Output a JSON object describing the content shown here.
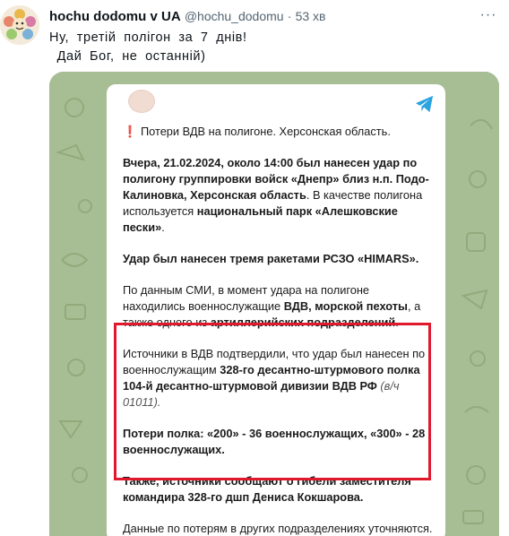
{
  "tweet": {
    "display_name": "hochu dodomu v UA",
    "handle": "@hochu_dodomu",
    "separator": "·",
    "time": "53 хв",
    "more_label": "···",
    "text_line1": "Ну, третій полігон за 7 днів!",
    "text_line2": " Дай Бог, не останній)"
  },
  "post": {
    "title": "Потери ВДВ на полигоне. Херсонская область.",
    "p1_a": "Вчера, 21.02.2024, около 14:00 был нанесен удар по полигону группировки войск «Днепр» близ н.п. Подо-Калиновка, Херсонская область",
    "p1_b": ". В качестве полигона используется ",
    "p1_c": "национальный парк «Алешковские пески»",
    "p1_d": ".",
    "p2": "Удар был нанесен тремя ракетами РСЗО «HIMARS».",
    "p3_a": "По данным СМИ, в момент удара на полигоне находились военнослужащие ",
    "p3_b": "ВДВ, морской пехоты",
    "p3_c": ", а также одного из ",
    "p3_d": "артиллерийских подразделений",
    "p3_e": ".",
    "p4_a": "Источники в ВДВ подтвердили, что удар был нанесен по военнослужащим ",
    "p4_b": "328-го десантно-штурмового полка 104-й десантно-штурмовой дивизии ВДВ РФ",
    "p4_c": " (в/ч 01011).",
    "p5": "Потери полка: «200» - 36 военнослужащих, «300» - 28 военнослужащих.",
    "p6": "Также, источники сообщают о гибели заместителя командира 328-го дшп Дениса Кокшарова.",
    "p7": "Данные по потерям в других подразделениях уточняются."
  },
  "colors": {
    "background_green": "#a7bd93",
    "highlight_red": "#e0192d",
    "telegram_blue": "#2aa3e0"
  }
}
